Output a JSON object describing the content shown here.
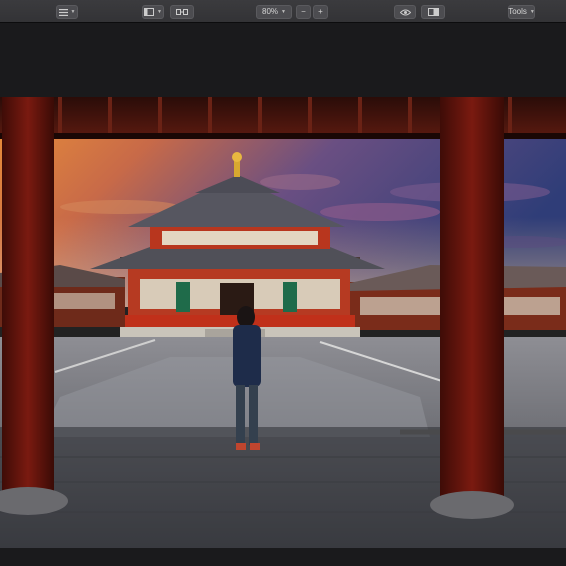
{
  "toolbar": {
    "view_menu_icon": "list-icon",
    "layout_icon": "sidebar-layout-icon",
    "compare_icon": "compare-icon",
    "zoom_value": "80%",
    "zoom_out_label": "−",
    "zoom_in_label": "+",
    "preview_icon": "eye-icon",
    "split_view_icon": "split-view-icon",
    "tools_label": "Tools"
  },
  "colors": {
    "toolbar_bg": "#37373a",
    "canvas_bg": "#1a1a1c",
    "pillar_red": "#7a1a10"
  }
}
